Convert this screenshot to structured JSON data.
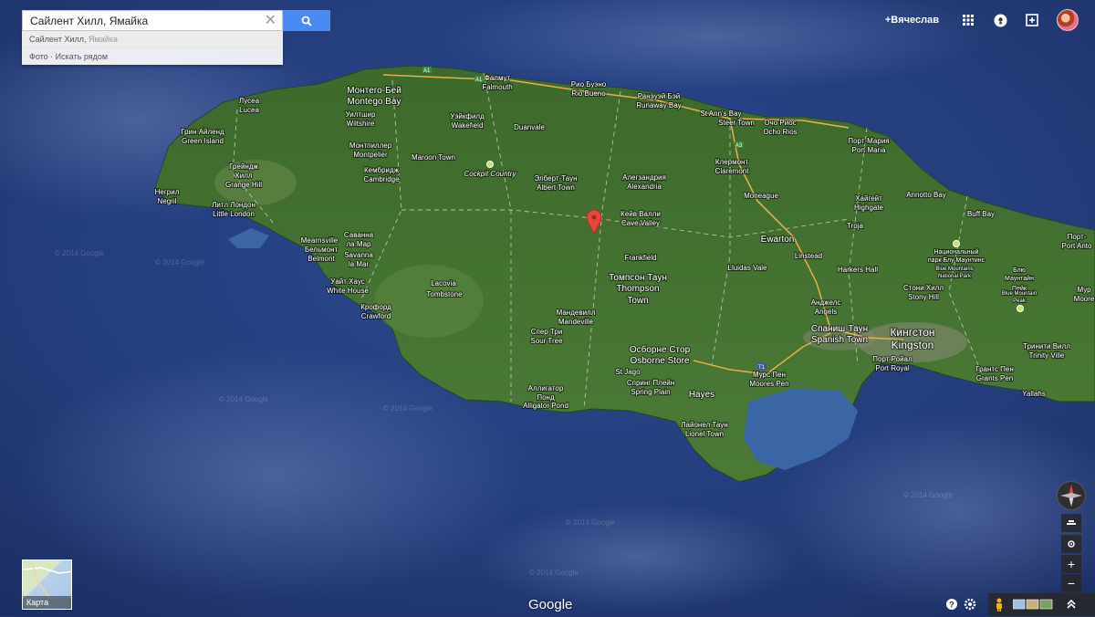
{
  "search": {
    "value": "Сайлент Хилл, Ямайка",
    "suggestion_main": "Сайлент Хилл, ",
    "suggestion_sub": "Ямайка",
    "photos": "Фото · Искать рядом"
  },
  "user": {
    "name": "+Вячеслав"
  },
  "map": {
    "labels": [
      {
        "id": "montego-bay",
        "t1": "Монтего-Бей",
        "t2": "Montego Bay"
      },
      {
        "id": "falmouth",
        "t1": "Фалмут",
        "t2": "Falmouth"
      },
      {
        "id": "rio-bueno",
        "t1": "Рио Буэно",
        "t2": "Rio Bueno"
      },
      {
        "id": "runaway-bay",
        "t1": "Ранэуэй Бэй",
        "t2": "Runaway Bay"
      },
      {
        "id": "st-anns-bay",
        "t1": "St Ann's Bay",
        "t2": ""
      },
      {
        "id": "steer-town",
        "t1": "Steer Town",
        "t2": ""
      },
      {
        "id": "ocho-rios",
        "t1": "Очо Риос",
        "t2": "Ocho Rios"
      },
      {
        "id": "port-maria",
        "t1": "Порт-Мария",
        "t2": "Port Maria"
      },
      {
        "id": "annotto-bay",
        "t1": "Annotto Bay",
        "t2": ""
      },
      {
        "id": "buff-bay",
        "t1": "Buff Bay",
        "t2": ""
      },
      {
        "id": "lucea",
        "t1": "Лусеа",
        "t2": "Lucea"
      },
      {
        "id": "green-island",
        "t1": "Грин Айленд",
        "t2": "Green Island"
      },
      {
        "id": "wiltshire",
        "t1": "Уилтшир",
        "t2": "Wiltshire"
      },
      {
        "id": "wakefield",
        "t1": "Уэйкфилд",
        "t2": "Wakefield"
      },
      {
        "id": "duanvale",
        "t1": "Duanvale",
        "t2": ""
      },
      {
        "id": "montpelier",
        "t1": "Монтпиллер",
        "t2": "Montpelier"
      },
      {
        "id": "maroon-town",
        "t1": "Maroon Town",
        "t2": ""
      },
      {
        "id": "cockpit-country",
        "t1": "Cockpit Country",
        "t2": ""
      },
      {
        "id": "grange-hill",
        "t1": "Грейндж",
        "t2": "Хилл"
      },
      {
        "id": "grange-hill-en",
        "t1": "Grange Hill",
        "t2": ""
      },
      {
        "id": "cambridge",
        "t1": "Кембридж",
        "t2": "Cambridge"
      },
      {
        "id": "albert-town",
        "t1": "Элберт-Таун",
        "t2": "Albert Town"
      },
      {
        "id": "alexandria",
        "t1": "Алегзандрия",
        "t2": "Alexandria"
      },
      {
        "id": "claremont",
        "t1": "Клермонт",
        "t2": "Claremont"
      },
      {
        "id": "moneague",
        "t1": "Moneague",
        "t2": ""
      },
      {
        "id": "highgate",
        "t1": "Хайгейт",
        "t2": "Highgate"
      },
      {
        "id": "negril",
        "t1": "Негрил",
        "t2": "Negril"
      },
      {
        "id": "little-london",
        "t1": "Литл Лондон",
        "t2": "Little London"
      },
      {
        "id": "cave-valley",
        "t1": "Кейв Валли",
        "t2": "Cave Valley"
      },
      {
        "id": "troja",
        "t1": "Troja",
        "t2": ""
      },
      {
        "id": "ewarton",
        "t1": "Ewarton",
        "t2": ""
      },
      {
        "id": "linstead",
        "t1": "Linstead",
        "t2": ""
      },
      {
        "id": "frankfield",
        "t1": "Frankfield",
        "t2": ""
      },
      {
        "id": "lluidas-vale",
        "t1": "Lluidas Vale",
        "t2": ""
      },
      {
        "id": "harkers-hall",
        "t1": "Harkers Hall",
        "t2": ""
      },
      {
        "id": "blue-mountains",
        "t1": "Национальный",
        "t2": "парк Блу Маунтинс"
      },
      {
        "id": "blue-mountains-en",
        "t1": "Blue Mountains",
        "t2": "National Park"
      },
      {
        "id": "port-antonio",
        "t1": "Порт-",
        "t2": "Port Anto"
      },
      {
        "id": "blue-mountain-peak",
        "t1": "Блю",
        "t2": "Маунтайн"
      },
      {
        "id": "blue-mountain-peak2",
        "t1": "Пейк",
        "t2": ""
      },
      {
        "id": "blue-mountain-peak-en",
        "t1": "Blue Mountain",
        "t2": "Peak"
      },
      {
        "id": "moore",
        "t1": "Мур",
        "t2": "Moore"
      },
      {
        "id": "mearnsville",
        "t1": "Mearnsville",
        "t2": ""
      },
      {
        "id": "belmont",
        "t1": "Бельмонт",
        "t2": "Belmont"
      },
      {
        "id": "savanna-la-mar",
        "t1": "Саванна",
        "t2": "ла Мар"
      },
      {
        "id": "savanna-la-mar-en",
        "t1": "Savanna",
        "t2": "la Mar"
      },
      {
        "id": "white-house",
        "t1": "Уайт Хаус",
        "t2": "White House"
      },
      {
        "id": "lacovia",
        "t1": "Lacovia",
        "t2": ""
      },
      {
        "id": "tombstone",
        "t1": "Tombstone",
        "t2": ""
      },
      {
        "id": "thompson-town",
        "t1": "Томпсон Таун",
        "t2": "Thompson"
      },
      {
        "id": "thompson-town2",
        "t1": "Town",
        "t2": ""
      },
      {
        "id": "crawford",
        "t1": "Крофорд",
        "t2": "Crawford"
      },
      {
        "id": "mandeville",
        "t1": "Мандевилл",
        "t2": "Mandeville"
      },
      {
        "id": "sour-tree",
        "t1": "Спер Три",
        "t2": "Sour Tree"
      },
      {
        "id": "osborne-store",
        "t1": "Осборне Стор",
        "t2": "Osborne Store"
      },
      {
        "id": "stony-hill",
        "t1": "Стони Хилл",
        "t2": "Stony Hill"
      },
      {
        "id": "angels",
        "t1": "Анджелс",
        "t2": "Angels"
      },
      {
        "id": "spanish-town",
        "t1": "Спаниш-Таун",
        "t2": "Spanish Town"
      },
      {
        "id": "kingston",
        "t1": "Кингстон",
        "t2": "Kingston"
      },
      {
        "id": "port-royal",
        "t1": "Порт Ройал",
        "t2": "Port Royal"
      },
      {
        "id": "trinity-ville",
        "t1": "Тринити Вилл",
        "t2": "Trinity Ville"
      },
      {
        "id": "grants-pen",
        "t1": "Грантс Пен",
        "t2": "Grants Pen"
      },
      {
        "id": "yallahs",
        "t1": "Yallahs",
        "t2": ""
      },
      {
        "id": "st-jago",
        "t1": "St Jago",
        "t2": ""
      },
      {
        "id": "spring-plain",
        "t1": "Спринг Плейн",
        "t2": "Spring Plain"
      },
      {
        "id": "hayes",
        "t1": "Hayes",
        "t2": ""
      },
      {
        "id": "moores-pen",
        "t1": "Мурс Пен",
        "t2": "Moores Pen"
      },
      {
        "id": "alligator-pond",
        "t1": "Аллигатор",
        "t2": "Понд"
      },
      {
        "id": "alligator-pond-en",
        "t1": "Alligator Pond",
        "t2": ""
      },
      {
        "id": "lionel-town",
        "t1": "Лайонел Таун",
        "t2": "Lionel Town"
      }
    ],
    "road_badges": [
      "A1",
      "A1",
      "A3",
      "A1"
    ],
    "watermark": "© 2014 Google"
  },
  "controls": {
    "minimap_label": "Карта",
    "google": "Google",
    "zoom_in": "+",
    "zoom_out": "−"
  },
  "colors": {
    "ocean": "#22356e",
    "land": "#3f6b2e",
    "search_blue": "#4a8af4",
    "marker": "#e8453c"
  }
}
